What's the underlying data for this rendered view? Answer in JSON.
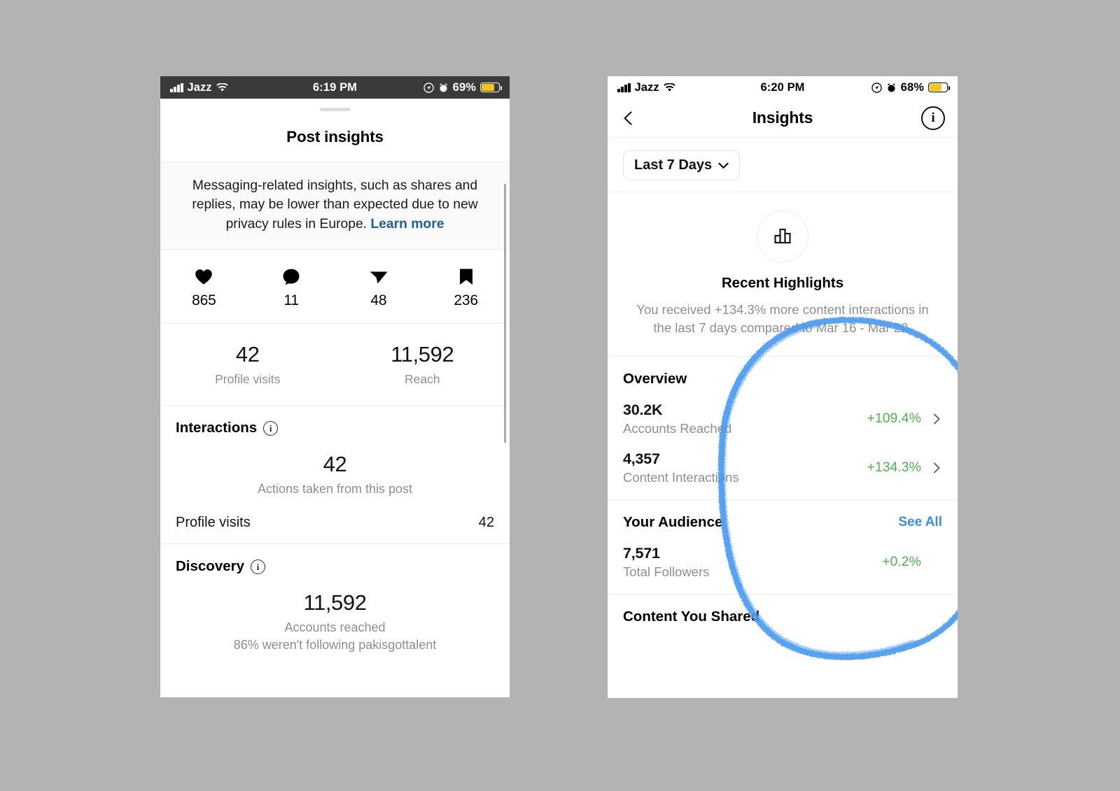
{
  "left_phone": {
    "status_bar": {
      "carrier": "Jazz",
      "time": "6:19 PM",
      "battery_percent": "69%",
      "signal_icon": "signal-bars-icon",
      "wifi_icon": "wifi-icon",
      "location_icon": "location-icon",
      "alarm_icon": "alarm-clock-icon",
      "battery_icon": "battery-icon"
    },
    "sheet_title": "Post insights",
    "notice": {
      "text": "Messaging-related insights, such as shares and replies, may be lower than expected due to new privacy rules in Europe. ",
      "link": "Learn more"
    },
    "engagement": [
      {
        "icon": "heart-icon",
        "value": "865"
      },
      {
        "icon": "comment-icon",
        "value": "11"
      },
      {
        "icon": "share-icon",
        "value": "48"
      },
      {
        "icon": "bookmark-icon",
        "value": "236"
      }
    ],
    "summary": [
      {
        "value": "42",
        "label": "Profile visits"
      },
      {
        "value": "11,592",
        "label": "Reach"
      }
    ],
    "interactions": {
      "heading": "Interactions",
      "info_icon": "info-icon",
      "value": "42",
      "caption": "Actions taken from this post",
      "rows": [
        {
          "label": "Profile visits",
          "value": "42"
        }
      ]
    },
    "discovery": {
      "heading": "Discovery",
      "info_icon": "info-icon",
      "value": "11,592",
      "caption": "Accounts reached",
      "subcaption": "86% weren't following pakisgottalent"
    }
  },
  "right_phone": {
    "status_bar": {
      "carrier": "Jazz",
      "time": "6:20 PM",
      "battery_percent": "68%",
      "signal_icon": "signal-bars-icon",
      "wifi_icon": "wifi-icon",
      "location_icon": "location-icon",
      "alarm_icon": "alarm-clock-icon",
      "battery_icon": "battery-icon"
    },
    "nav": {
      "back_icon": "back-chevron-icon",
      "title": "Insights",
      "info_icon": "info-icon"
    },
    "filter": {
      "label": "Last 7 Days",
      "chevron_icon": "chevron-down-icon"
    },
    "highlights": {
      "icon": "bar-chart-icon",
      "title": "Recent Highlights",
      "body": "You received +134.3% more content interactions in the last 7 days compared to Mar 16 - Mar 22."
    },
    "overview": {
      "heading": "Overview",
      "rows": [
        {
          "value": "30.2K",
          "caption": "Accounts Reached",
          "delta": "+109.4%",
          "chevron_icon": "chevron-right-icon"
        },
        {
          "value": "4,357",
          "caption": "Content Interactions",
          "delta": "+134.3%",
          "chevron_icon": "chevron-right-icon"
        }
      ]
    },
    "audience": {
      "heading": "Your Audience",
      "see_all": "See All",
      "rows": [
        {
          "value": "7,571",
          "caption": "Total Followers",
          "delta": "+0.2%"
        }
      ]
    },
    "content_shared": {
      "heading": "Content You Shared"
    },
    "annotation": {
      "shape": "hand-drawn-oval",
      "color": "#4a9bf0"
    }
  },
  "colors": {
    "background": "#b3b3b3",
    "accent_blue": "#3a8cf0",
    "positive_green": "#48b44b",
    "link_blue": "#1a5e9e",
    "battery_yellow": "#f5c518",
    "annotation_blue": "#4a9bf0"
  }
}
